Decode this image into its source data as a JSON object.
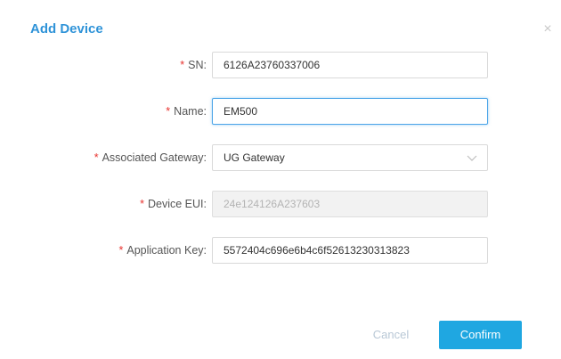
{
  "dialog": {
    "title": "Add Device",
    "close_glyph": "×"
  },
  "form": {
    "sn": {
      "label": "SN:",
      "value": "6126A23760337006"
    },
    "name": {
      "label": "Name:",
      "value": "EM500"
    },
    "gateway": {
      "label": "Associated Gateway:",
      "value": "UG Gateway"
    },
    "eui": {
      "label": "Device EUI:",
      "value": "24e124126A237603"
    },
    "app_key": {
      "label": "Application Key:",
      "value": "5572404c696e6b4c6f52613230313823"
    },
    "required_mark": "*"
  },
  "buttons": {
    "cancel": "Cancel",
    "confirm": "Confirm"
  },
  "colors": {
    "title": "#2f93d8",
    "required": "#e8322e",
    "primary": "#1fa7e1",
    "focus": "#4ca5e8"
  },
  "icons": {
    "close": "close-icon",
    "dropdown": "chevron-down-icon"
  }
}
